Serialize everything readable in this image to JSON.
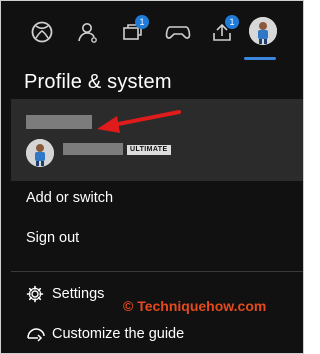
{
  "nav": {
    "social_badge": "1",
    "upload_badge": "1"
  },
  "title": "Profile & system",
  "profile": {
    "tier": "ULTIMATE"
  },
  "menu": {
    "add_switch": "Add or switch",
    "sign_out": "Sign out",
    "settings": "Settings",
    "customize": "Customize the guide"
  },
  "watermark": "© Techniquehow.com",
  "colors": {
    "background": "#111111",
    "panel": "#2b2b2b",
    "accent_blue": "#3c86e0",
    "arrow_red": "#e01b1b",
    "watermark": "#e44a1d"
  }
}
